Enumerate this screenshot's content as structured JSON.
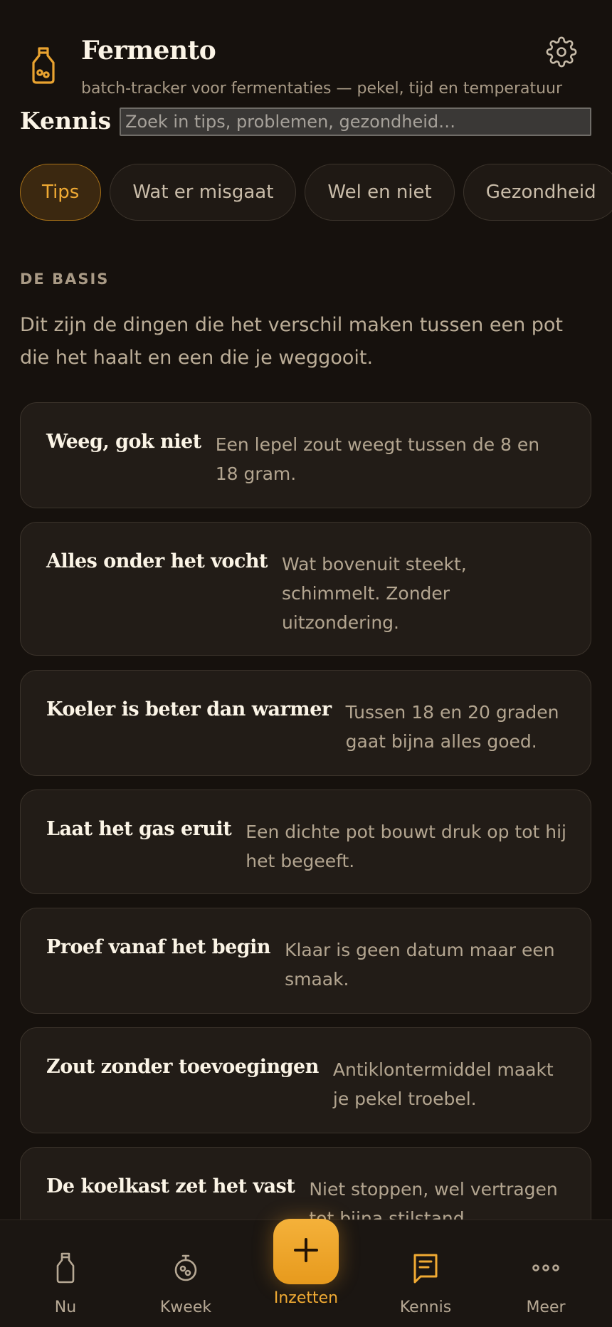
{
  "app": {
    "title": "Fermento",
    "subtitle": "batch-tracker voor fermentaties — pekel, tijd en temperatuur",
    "logo_icon": "bottle-icon",
    "settings_icon": "gear-icon"
  },
  "section": {
    "title": "Kennis",
    "search_placeholder": "Zoek in tips, problemen, gezondheid…"
  },
  "tabs": [
    {
      "label": "Tips",
      "active": true
    },
    {
      "label": "Wat er misgaat",
      "active": false
    },
    {
      "label": "Wel en niet",
      "active": false
    },
    {
      "label": "Gezondheid",
      "active": false
    }
  ],
  "basis": {
    "eyebrow": "DE BASIS",
    "intro": "Dit zijn de dingen die het verschil maken tussen een pot die het haalt en een die je weggooit."
  },
  "cards": [
    {
      "title": "Weeg, gok niet",
      "text": "Een lepel zout weegt tussen de 8 en 18 gram."
    },
    {
      "title": "Alles onder het vocht",
      "text": "Wat bovenuit steekt, schimmelt. Zonder uitzondering."
    },
    {
      "title": "Koeler is beter dan warmer",
      "text": "Tussen 18 en 20 graden gaat bijna alles goed."
    },
    {
      "title": "Laat het gas eruit",
      "text": "Een dichte pot bouwt druk op tot hij het begeeft."
    },
    {
      "title": "Proef vanaf het begin",
      "text": "Klaar is geen datum maar een smaak."
    },
    {
      "title": "Zout zonder toevoegingen",
      "text": "Antiklontermiddel maakt je pekel troebel."
    },
    {
      "title": "De koelkast zet het vast",
      "text": "Niet stoppen, wel vertragen tot bijna stilstand."
    }
  ],
  "nav": {
    "items": [
      {
        "label": "Nu",
        "icon": "bottle-icon",
        "active": false
      },
      {
        "label": "Kweek",
        "icon": "culture-jar-icon",
        "active": false
      },
      {
        "label": "Inzetten",
        "icon": "plus-icon",
        "active": false
      },
      {
        "label": "Kennis",
        "icon": "book-icon",
        "active": true
      },
      {
        "label": "Meer",
        "icon": "more-dots-icon",
        "active": false
      }
    ]
  },
  "colors": {
    "accent": "#f0aa33",
    "background": "#16110d",
    "card": "#221c17"
  }
}
